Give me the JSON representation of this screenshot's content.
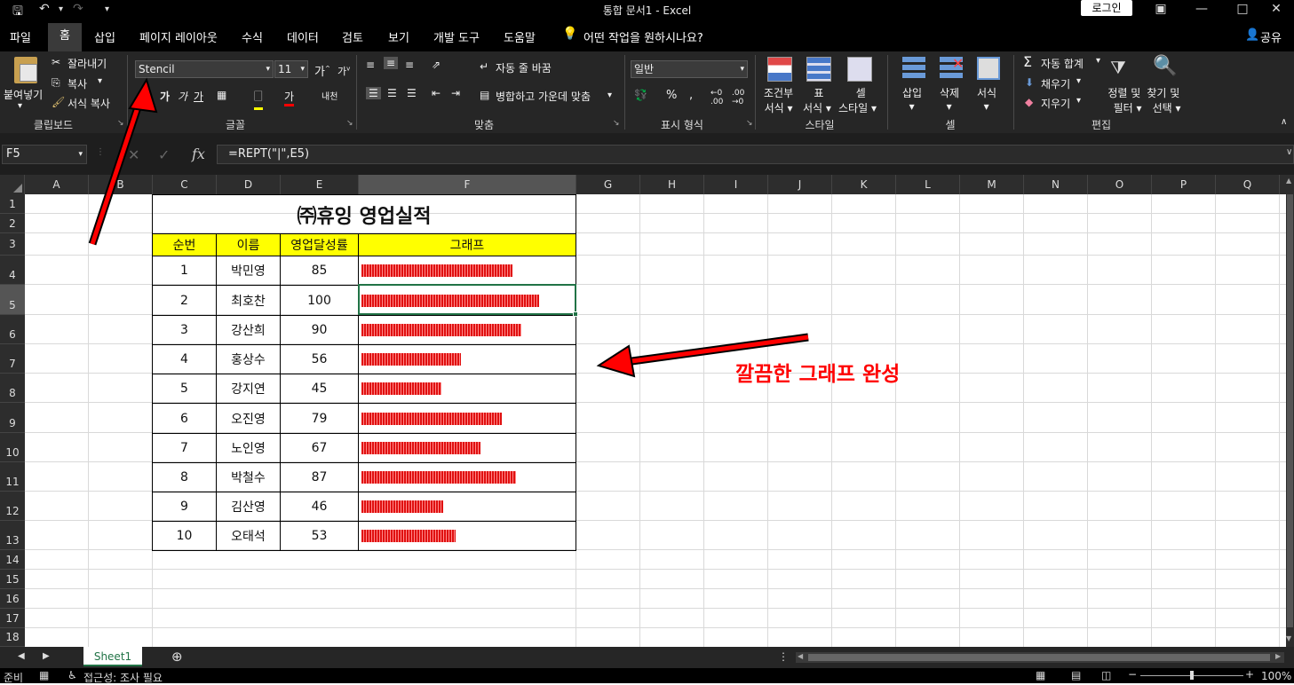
{
  "titlebar": {
    "title": "통합 문서1  -  Excel",
    "login": "로그인"
  },
  "tabs": [
    "파일",
    "홈",
    "삽입",
    "페이지 레이아웃",
    "수식",
    "데이터",
    "검토",
    "보기",
    "개발 도구",
    "도움말"
  ],
  "tell_me": "어떤 작업을 원하시나요?",
  "share": "공유",
  "ribbon": {
    "paste": "붙여넣기",
    "cut": "잘라내기",
    "copy": "복사",
    "format_painter": "서식 복사",
    "font_name": "Stencil",
    "font_size": "11",
    "wrap_text": "자동 줄 바꿈",
    "merge_center": "병합하고 가운데 맞춤",
    "number_format": "일반",
    "cond_format": [
      "조건부",
      "서식"
    ],
    "format_table": [
      "표",
      "서식"
    ],
    "cell_styles": [
      "셀",
      "스타일"
    ],
    "insert": "삽입",
    "delete": "삭제",
    "format": "서식",
    "autosum": "자동 합계",
    "fill": "채우기",
    "clear": "지우기",
    "sort_filter": [
      "정렬 및",
      "필터"
    ],
    "find_select": [
      "찾기 및",
      "선택"
    ],
    "groups": [
      "클립보드",
      "글꼴",
      "맞춤",
      "표시 형식",
      "스타일",
      "셀",
      "편집"
    ]
  },
  "formula_bar": {
    "name_box": "F5",
    "formula": "=REPT(\"|\",E5)"
  },
  "columns": [
    "A",
    "B",
    "C",
    "D",
    "E",
    "F",
    "G",
    "H",
    "I",
    "J",
    "K",
    "L",
    "M",
    "N",
    "O",
    "P",
    "Q"
  ],
  "rows": [
    "1",
    "2",
    "3",
    "4",
    "5",
    "6",
    "7",
    "8",
    "9",
    "10",
    "11",
    "12",
    "13",
    "14",
    "15",
    "16",
    "17",
    "18"
  ],
  "table": {
    "title": "㈜휴잉 영업실적",
    "headers": [
      "순번",
      "이름",
      "영업달성률",
      "그래프"
    ],
    "records": [
      {
        "no": "1",
        "name": "박민영",
        "rate": "85"
      },
      {
        "no": "2",
        "name": "최호찬",
        "rate": "100"
      },
      {
        "no": "3",
        "name": "강산희",
        "rate": "90"
      },
      {
        "no": "4",
        "name": "홍상수",
        "rate": "56"
      },
      {
        "no": "5",
        "name": "강지연",
        "rate": "45"
      },
      {
        "no": "6",
        "name": "오진영",
        "rate": "79"
      },
      {
        "no": "7",
        "name": "노인영",
        "rate": "67"
      },
      {
        "no": "8",
        "name": "박철수",
        "rate": "87"
      },
      {
        "no": "9",
        "name": "김산영",
        "rate": "46"
      },
      {
        "no": "10",
        "name": "오태석",
        "rate": "53"
      }
    ]
  },
  "annotation": "깔끔한 그래프 완성",
  "sheet_tab": "Sheet1",
  "status": {
    "ready": "준비",
    "accessibility": "접근성: 조사 필요",
    "zoom": "100%"
  },
  "colors": {
    "header_fill": "#ffff00",
    "bar": "#e01010",
    "arrow": "#ff0000",
    "annotation": "#ff0000"
  }
}
